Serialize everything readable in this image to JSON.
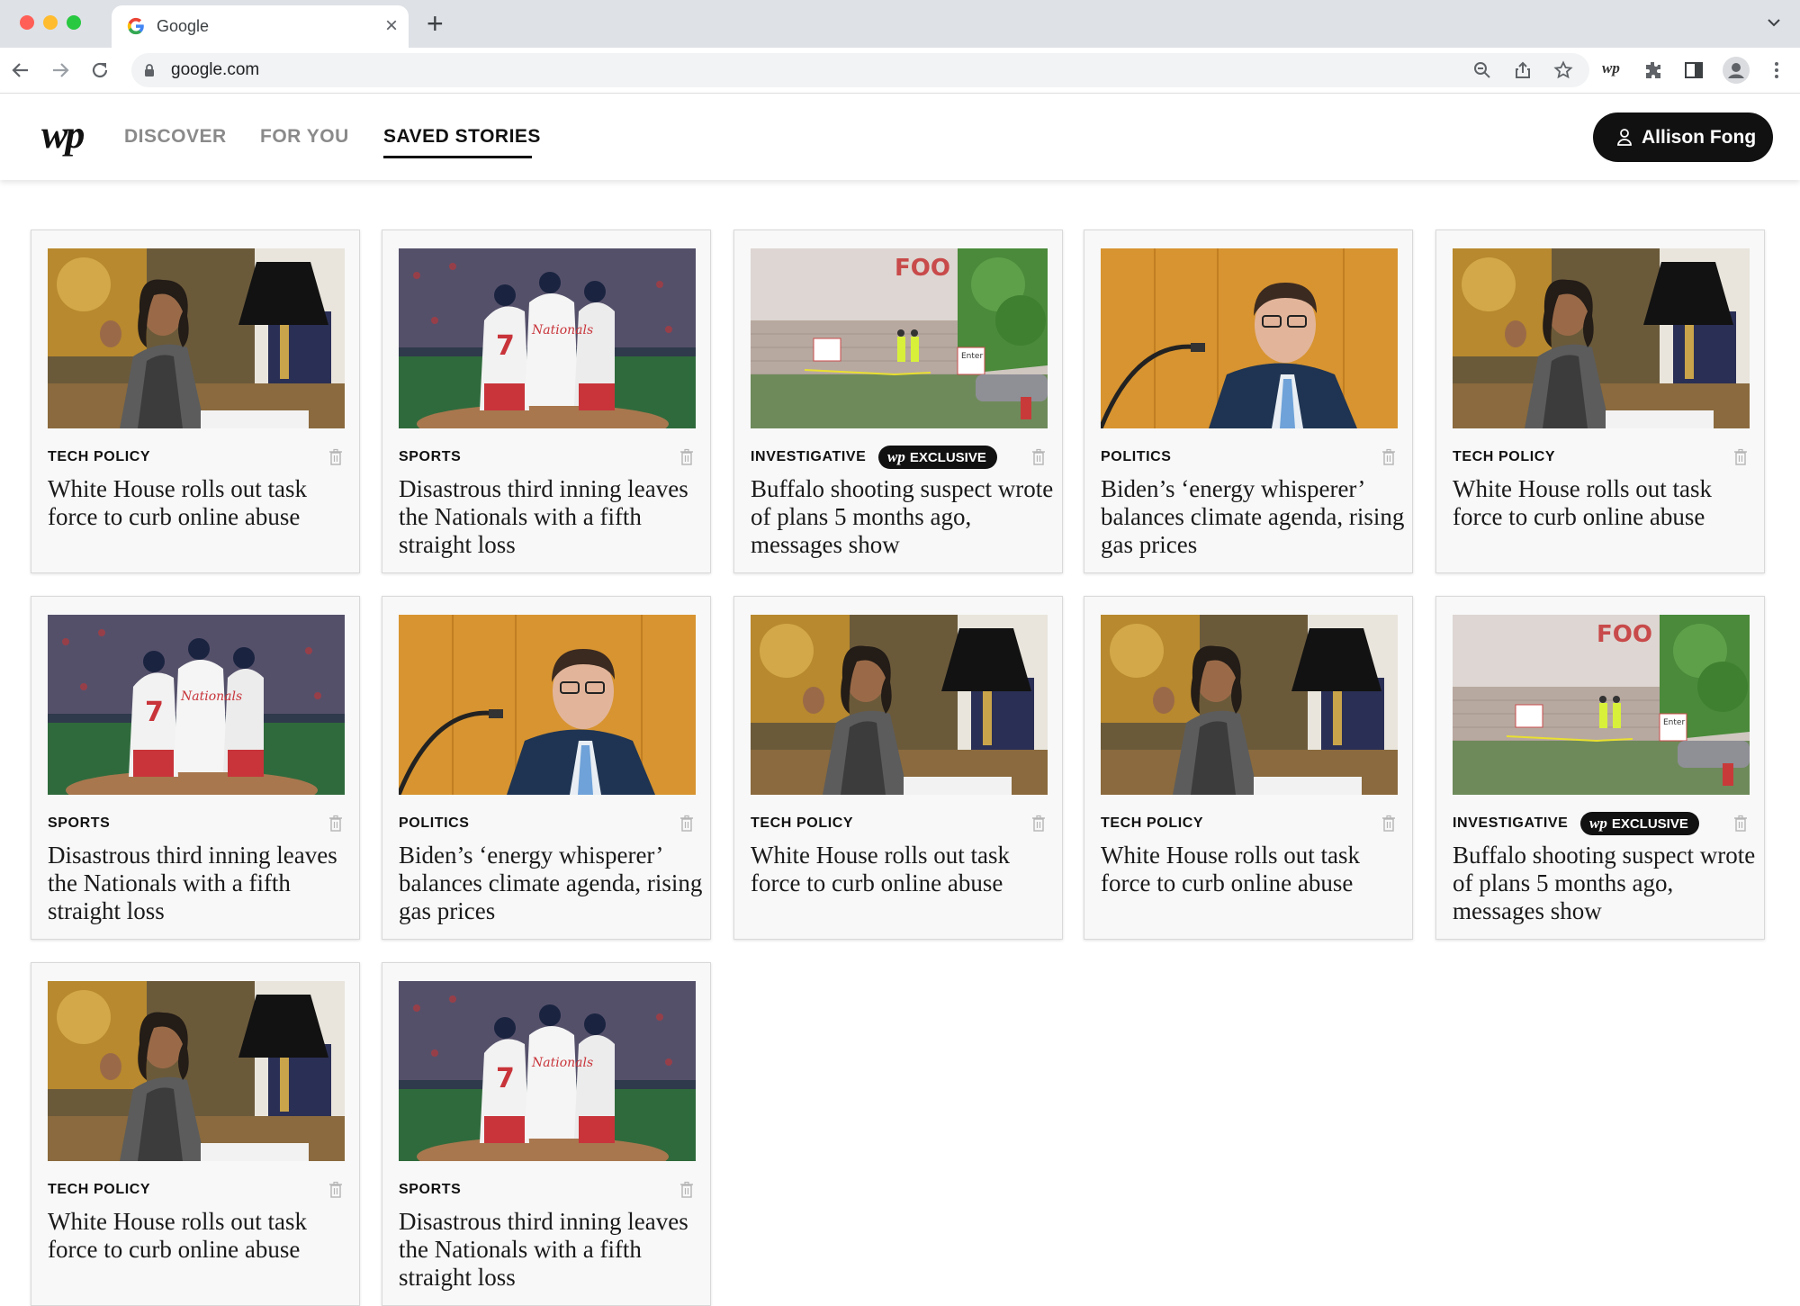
{
  "browser": {
    "tab_title": "Google",
    "url": "google.com",
    "colors": {
      "close": "#ff5f57",
      "minimize": "#febc2e",
      "maximize": "#28c840"
    }
  },
  "site": {
    "logo": "wp",
    "nav": [
      {
        "label": "DISCOVER",
        "active": false
      },
      {
        "label": "FOR YOU",
        "active": false
      },
      {
        "label": "SAVED STORIES",
        "active": true
      }
    ],
    "user_name": "Allison Fong",
    "badge_logo": "wp",
    "badge_label": "EXCLUSIVE"
  },
  "cards": [
    {
      "category": "TECH POLICY",
      "headline": "White House rolls out task force to curb online abuse",
      "image": "harris",
      "exclusive": false
    },
    {
      "category": "SPORTS",
      "headline": "Disastrous third inning leaves the Nationals with a fifth straight loss",
      "image": "baseball",
      "exclusive": false
    },
    {
      "category": "INVESTIGATIVE",
      "headline": "Buffalo shooting suspect wrote of plans 5 months ago, messages show",
      "image": "store",
      "exclusive": true
    },
    {
      "category": "POLITICS",
      "headline": "Biden’s ‘energy whisperer’ balances climate agenda, rising gas prices",
      "image": "official",
      "exclusive": false
    },
    {
      "category": "TECH POLICY",
      "headline": "White House rolls out task force to curb online abuse",
      "image": "harris",
      "exclusive": false
    },
    {
      "category": "SPORTS",
      "headline": "Disastrous third inning leaves the Nationals with a fifth straight loss",
      "image": "baseball",
      "exclusive": false
    },
    {
      "category": "POLITICS",
      "headline": "Biden’s ‘energy whisperer’ balances climate agenda, rising gas prices",
      "image": "official",
      "exclusive": false
    },
    {
      "category": "TECH POLICY",
      "headline": "White House rolls out task force to curb online abuse",
      "image": "harris",
      "exclusive": false
    },
    {
      "category": "TECH POLICY",
      "headline": "White House rolls out task force to curb online abuse",
      "image": "harris",
      "exclusive": false
    },
    {
      "category": "INVESTIGATIVE",
      "headline": "Buffalo shooting suspect wrote of plans 5 months ago, messages show",
      "image": "store",
      "exclusive": true
    },
    {
      "category": "TECH POLICY",
      "headline": "White House rolls out task force to curb online abuse",
      "image": "harris",
      "exclusive": false
    },
    {
      "category": "SPORTS",
      "headline": "Disastrous third inning leaves the Nationals with a fifth straight loss",
      "image": "baseball",
      "exclusive": false
    }
  ],
  "image_text": {
    "store_sign": "FOO",
    "door_sign": "Enter",
    "jersey_number": "7",
    "jersey_team": "Nationals"
  }
}
